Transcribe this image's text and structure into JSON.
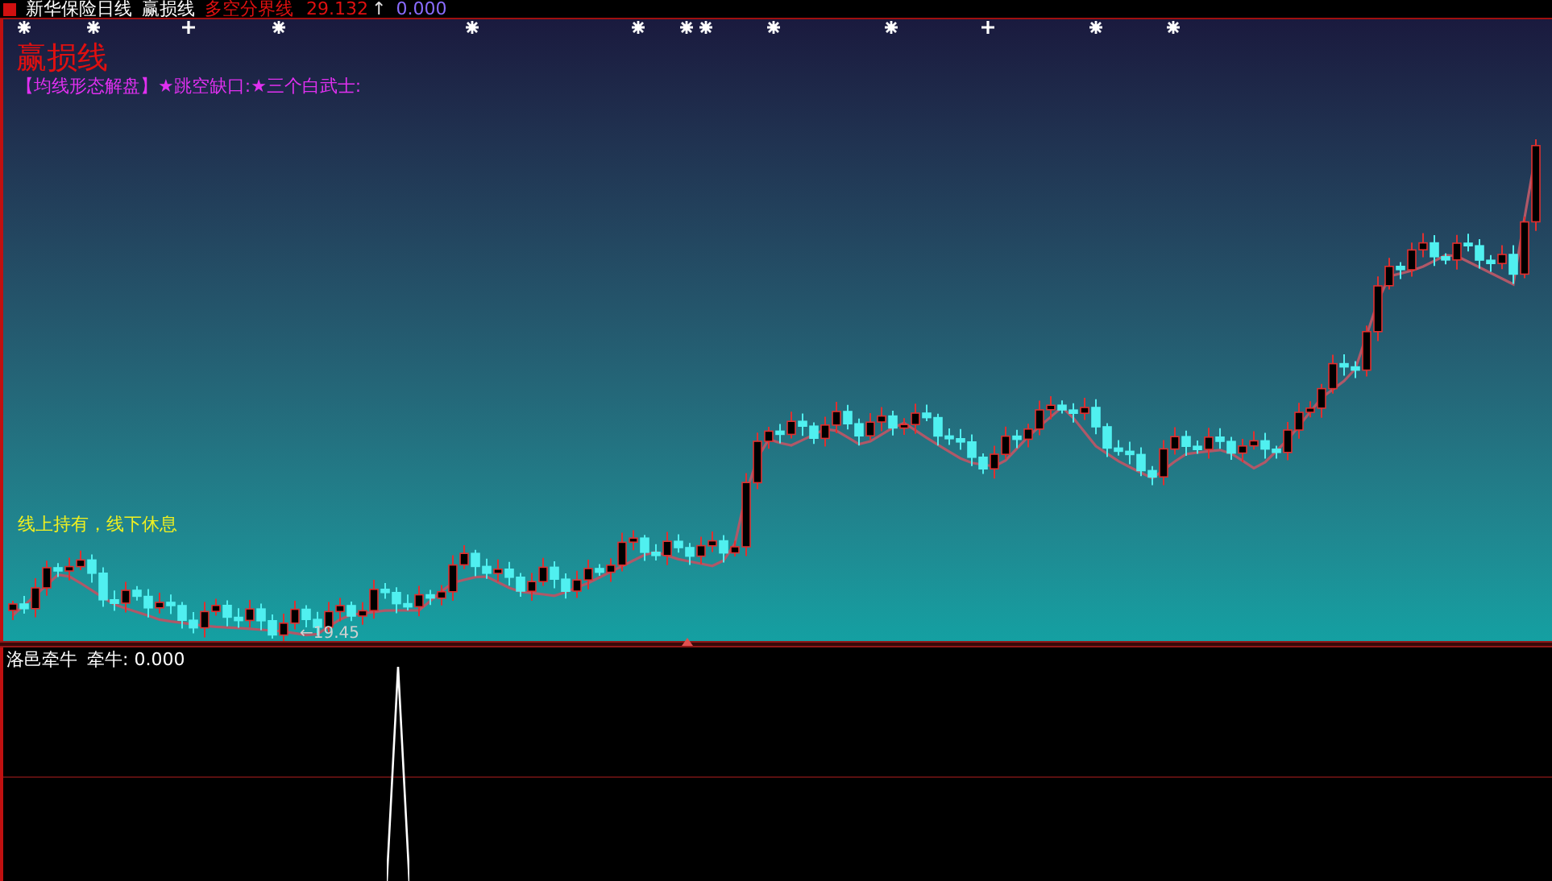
{
  "header": {
    "title": "新华保险日线",
    "indicator": "赢损线",
    "line_name": "多空分界线",
    "line_value": "29.132",
    "arrow": "↑",
    "value_2": "0.000"
  },
  "signals": [
    {
      "kind": "star"
    },
    {
      "kind": "star"
    },
    {
      "kind": "plus"
    },
    {
      "kind": "star"
    },
    {
      "kind": "star"
    },
    {
      "kind": "star"
    },
    {
      "kind": "star"
    },
    {
      "kind": "star"
    },
    {
      "kind": "star"
    },
    {
      "kind": "star"
    },
    {
      "kind": "plus"
    },
    {
      "kind": "star"
    },
    {
      "kind": "star"
    }
  ],
  "main_pane": {
    "title": "赢损线",
    "signal_legend": "【均线形态解盘】★跳空缺口:★三个白武士:",
    "hint": "线上持有，线下休息",
    "low_label": "←19.45"
  },
  "lower_pane": {
    "title": "洛邑牵牛",
    "reading": "牵牛: 0.000"
  }
}
